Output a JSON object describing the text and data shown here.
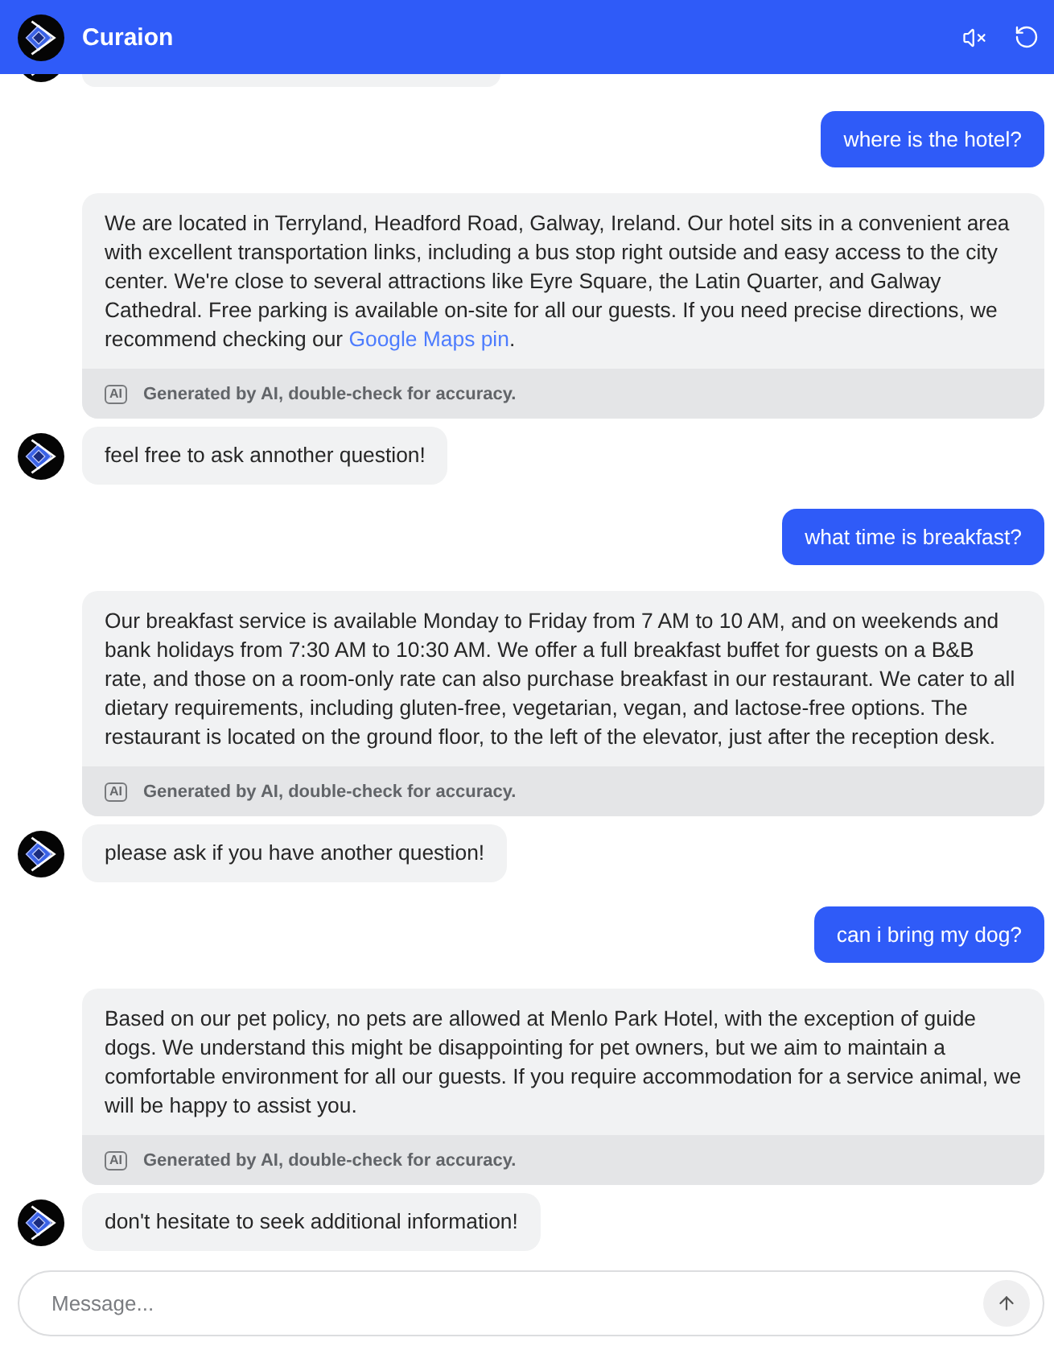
{
  "header": {
    "title": "Curaion"
  },
  "messages": [
    {
      "kind": "partial",
      "show_avatar": true
    },
    {
      "kind": "user",
      "text": "where is the hotel?"
    },
    {
      "kind": "bot",
      "show_avatar": false,
      "parts": [
        {
          "kind": "text",
          "text": "We are located in Terryland, Headford Road, Galway, Ireland. Our hotel sits in a convenient area with excellent transportation links, including a bus stop right outside and easy access to the city center. We're close to several attractions like Eyre Square, the Latin Quarter, and Galway Cathedral. Free parking is available on-site for all our guests. If you need precise directions, we recommend checking our "
        },
        {
          "kind": "link",
          "text": "Google Maps pin"
        },
        {
          "kind": "text",
          "text": "."
        }
      ],
      "footer": {
        "badge": "AI",
        "note": "Generated by AI, double-check for accuracy."
      }
    },
    {
      "kind": "bot",
      "show_avatar": true,
      "parts": [
        {
          "kind": "text",
          "text": "feel free to ask annother question!"
        }
      ]
    },
    {
      "kind": "user",
      "text": "what time is breakfast?"
    },
    {
      "kind": "bot",
      "show_avatar": false,
      "parts": [
        {
          "kind": "text",
          "text": "Our breakfast service is available Monday to Friday from 7 AM to 10 AM, and on weekends and bank holidays from 7:30 AM to 10:30 AM. We offer a full breakfast buffet for guests on a B&B rate, and those on a room-only rate can also purchase breakfast in our restaurant. We cater to all dietary requirements, including gluten-free, vegetarian, vegan, and lactose-free options. The restaurant is located on the ground floor, to the left of the elevator, just after the reception desk."
        }
      ],
      "footer": {
        "badge": "AI",
        "note": "Generated by AI, double-check for accuracy."
      }
    },
    {
      "kind": "bot",
      "show_avatar": true,
      "parts": [
        {
          "kind": "text",
          "text": "please ask if you have another question!"
        }
      ]
    },
    {
      "kind": "user",
      "text": "can i bring my dog?"
    },
    {
      "kind": "bot",
      "show_avatar": false,
      "parts": [
        {
          "kind": "text",
          "text": "Based on our pet policy, no pets are allowed at Menlo Park Hotel, with the exception of guide dogs. We understand this might be disappointing for pet owners, but we aim to maintain a comfortable environment for all our guests. If you require accommodation for a service animal, we will be happy to assist you."
        }
      ],
      "footer": {
        "badge": "AI",
        "note": "Generated by AI, double-check for accuracy."
      }
    },
    {
      "kind": "bot",
      "show_avatar": true,
      "parts": [
        {
          "kind": "text",
          "text": "don't hesitate to seek additional information!"
        }
      ]
    }
  ],
  "composer": {
    "placeholder": "Message..."
  }
}
